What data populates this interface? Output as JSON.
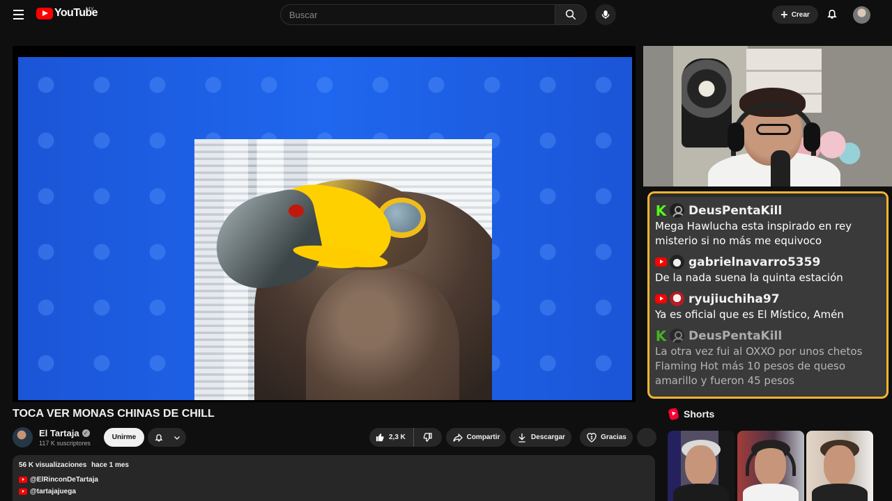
{
  "header": {
    "logo_text": "YouTube",
    "country_code": "MX",
    "search_placeholder": "Buscar",
    "create_label": "Crear",
    "icons": [
      "menu-icon",
      "search-icon",
      "microphone-icon",
      "plus-icon",
      "bell-icon"
    ]
  },
  "player": {
    "content": "hawk-photo"
  },
  "stream_chat": {
    "messages": [
      {
        "platform": "kick",
        "username": "DeusPentaKill",
        "text": "Mega Hawlucha esta inspirado en rey misterio si no más me equivoco"
      },
      {
        "platform": "youtube",
        "username": "gabrielnavarro5359",
        "text": "De la nada suena la quinta estación"
      },
      {
        "platform": "youtube",
        "username": "ryujiuchiha97",
        "text": "Ya es oficial que es El Místico, Amén"
      },
      {
        "platform": "kick",
        "username": "DeusPentaKill",
        "text": "La otra vez fui al OXXO por unos chetos Flaming Hot más 10 pesos de queso amarillo y fueron 45 pesos"
      }
    ],
    "accent_color": "#f6b52d"
  },
  "video": {
    "title": "TOCA VER MONAS CHINAS DE CHILL",
    "channel_name": "El Tartaja",
    "subscribers": "117 K suscriptores",
    "join_label": "Unirme",
    "likes": "2,3 K",
    "share_label": "Compartir",
    "download_label": "Descargar",
    "thanks_label": "Gracias"
  },
  "description": {
    "views": "56 K visualizaciones",
    "time_ago": "hace 1 mes",
    "links": [
      "@ElRinconDeTartaja",
      "@tartajajuega"
    ]
  },
  "shorts": {
    "title": "Shorts"
  }
}
